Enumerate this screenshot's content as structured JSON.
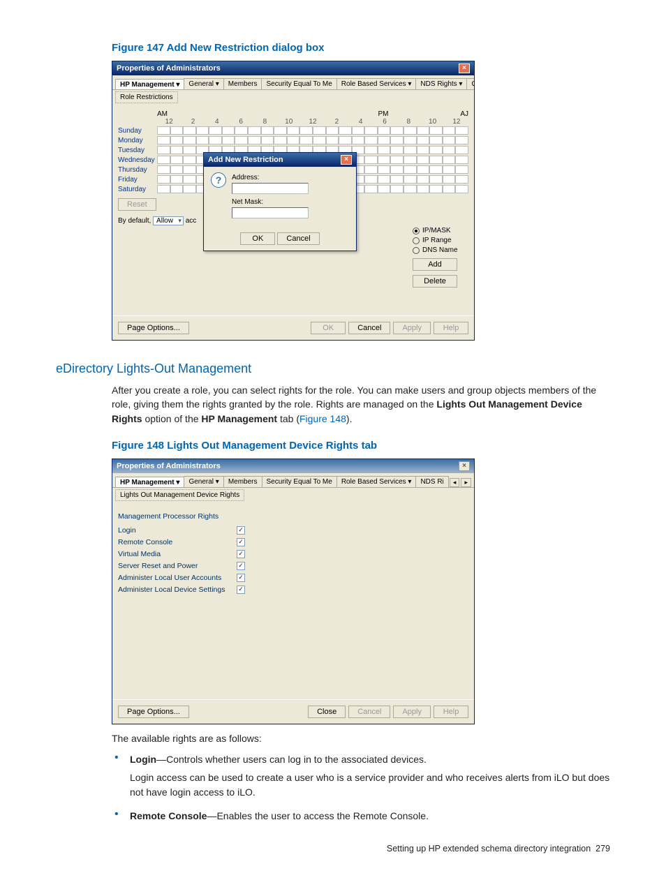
{
  "figure147": {
    "caption": "Figure 147 Add New Restriction dialog box",
    "dialog": {
      "title": "Properties of Administrators",
      "tabs": [
        "HP Management  ▾",
        "General  ▾",
        "Members",
        "Security Equal To Me",
        "Role Based Services  ▾",
        "NDS Rights  ▾",
        "Other"
      ],
      "subtab": "Role Restrictions",
      "time_labels": {
        "am": "AM",
        "pm": "PM",
        "aj": "AJ"
      },
      "hours": [
        "12",
        "2",
        "4",
        "6",
        "8",
        "10",
        "12",
        "2",
        "4",
        "6",
        "8",
        "10",
        "12"
      ],
      "days": [
        "Sunday",
        "Monday",
        "Tuesday",
        "Wednesday",
        "Thursday",
        "Friday",
        "Saturday"
      ],
      "reset": "Reset",
      "default_prefix": "By default,",
      "default_select": "Allow",
      "default_suffix": "acc",
      "radios": [
        {
          "label": "IP/MASK",
          "selected": true
        },
        {
          "label": "IP Range",
          "selected": false
        },
        {
          "label": "DNS Name",
          "selected": false
        }
      ],
      "side_add": "Add",
      "side_delete": "Delete",
      "inner": {
        "title": "Add New Restriction",
        "address": "Address:",
        "netmask": "Net Mask:",
        "ok": "OK",
        "cancel": "Cancel"
      },
      "footer": {
        "page_options": "Page Options...",
        "ok": "OK",
        "cancel": "Cancel",
        "apply": "Apply",
        "help": "Help"
      }
    }
  },
  "section_heading": "eDirectory Lights-Out Management",
  "para1_a": "After you create a role, you can select rights for the role. You can make users and group objects members of the role, giving them the rights granted by the role. Rights are managed on the ",
  "para1_b": "Lights Out Management Device Rights",
  "para1_c": " option of the ",
  "para1_d": "HP Management",
  "para1_e": " tab (",
  "para1_link": "Figure 148",
  "para1_f": ").",
  "figure148": {
    "caption": "Figure 148 Lights Out Management Device Rights tab",
    "dialog": {
      "title": "Properties of Administrators",
      "active_tab": "HP Management",
      "tabs": [
        "General  ▾",
        "Members",
        "Security Equal To Me",
        "Role Based Services  ▾",
        "NDS Ri"
      ],
      "subtab": "Lights Out Management Device Rights",
      "heading": "Management Processor Rights",
      "rights": [
        {
          "label": "Login",
          "checked": true
        },
        {
          "label": "Remote Console",
          "checked": true
        },
        {
          "label": "Virtual Media",
          "checked": true
        },
        {
          "label": "Server Reset and Power",
          "checked": true
        },
        {
          "label": "Administer Local User Accounts",
          "checked": true
        },
        {
          "label": "Administer Local Device Settings",
          "checked": true
        }
      ],
      "footer": {
        "page_options": "Page Options...",
        "close": "Close",
        "cancel": "Cancel",
        "apply": "Apply",
        "help": "Help"
      }
    }
  },
  "rights_intro": "The available rights are as follows:",
  "bullets": {
    "login_name": "Login",
    "login_desc": "—Controls whether users can log in to the associated devices.",
    "login_sub": "Login access can be used to create a user who is a service provider and who receives alerts from iLO but does not have login access to iLO.",
    "rc_name": "Remote Console",
    "rc_desc": "—Enables the user to access the Remote Console."
  },
  "footer_text": "Setting up HP extended schema directory integration",
  "page_no": "279"
}
